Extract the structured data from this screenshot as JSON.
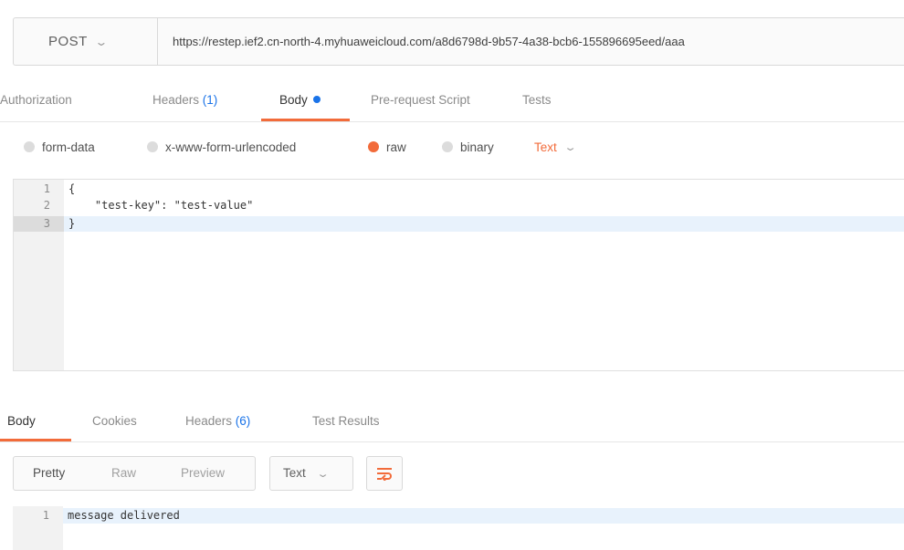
{
  "request": {
    "method": "POST",
    "url": "https://restep.ief2.cn-north-4.myhuaweicloud.com/a8d6798d-9b57-4a38-bcb6-155896695eed/aaa"
  },
  "request_tabs": [
    {
      "label": "Authorization"
    },
    {
      "label": "Headers",
      "count": "(1)"
    },
    {
      "label": "Body"
    },
    {
      "label": "Pre-request Script"
    },
    {
      "label": "Tests"
    }
  ],
  "body_modes": {
    "options": [
      "form-data",
      "x-www-form-urlencoded",
      "raw",
      "binary"
    ],
    "selected": "raw",
    "format": "Text"
  },
  "editor": {
    "line_numbers": [
      "1",
      "2",
      "3"
    ],
    "lines": [
      "{",
      "    \"test-key\": \"test-value\"",
      "}"
    ]
  },
  "response_tabs": [
    {
      "label": "Body"
    },
    {
      "label": "Cookies"
    },
    {
      "label": "Headers",
      "count": "(6)"
    },
    {
      "label": "Test Results"
    }
  ],
  "response_toolbar": {
    "views": [
      "Pretty",
      "Raw",
      "Preview"
    ],
    "selected_view": "Pretty",
    "format": "Text"
  },
  "response_body": {
    "line_numbers": [
      "1"
    ],
    "lines": [
      "message delivered"
    ]
  },
  "colors": {
    "accent": "#f26b3a",
    "link_blue": "#1a73e8",
    "highlight": "#e8f2fc"
  },
  "icons": [
    "chevron-down-icon",
    "wrap-lines-icon",
    "active-dot-icon"
  ]
}
